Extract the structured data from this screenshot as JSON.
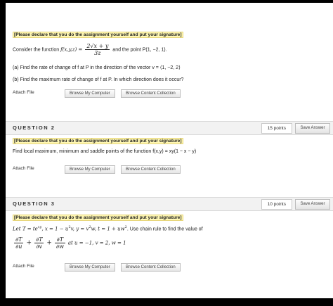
{
  "q1": {
    "declare": "[Please declare that you do the assignment yourself and put your signature]",
    "consider_prefix": "Consider the function",
    "function_lhs": "f(x,y,z) =",
    "numerator": "2√x + y",
    "denominator": "3z",
    "point_text": "and the point P(1, −2, 1).",
    "part_a": "(a) Find the rate of change of f at P in the direction of the vector v = ⟨1, −2, 2⟩",
    "part_b": "(b) Find the maximum rate of change of f at P. In which direction does it occur?",
    "attach_label": "Attach File",
    "browse_label": "Browse My Computer",
    "collection_label": "Browse Content Collection"
  },
  "q2": {
    "title": "QUESTION 2",
    "points": "15 points",
    "save_label": "Save Answer",
    "declare": "[Please declare that you do the assignment yourself and put your signature]",
    "prompt": "Find local maximum, minimum and saddle points of the function f(x,y) = xy(1 − x − y)",
    "attach_label": "Attach File",
    "browse_label": "Browse My Computer",
    "collection_label": "Browse Content Collection"
  },
  "q3": {
    "title": "QUESTION 3",
    "points": "10 points",
    "save_label": "Save Answer",
    "declare": "[Please declare that you do the assignment yourself and put your signature]",
    "let_line": "Let T = te",
    "let_exp": "xy",
    "let_rest": ", x = 1 − u",
    "u_exp": "2",
    "let_rest2": "v, y = v",
    "v_exp": "2",
    "let_rest3": "w, t = 1 + uw",
    "w_exp": "2",
    "let_tail": ". Use chain rule to find the value of",
    "d1_num": "∂T",
    "d1_den": "∂u",
    "d2_num": "∂T",
    "d2_den": "∂v",
    "d3_num": "∂T",
    "d3_den": "∂w",
    "at_text": "at u = −1, v = 2, w = 1",
    "attach_label": "Attach File",
    "browse_label": "Browse My Computer",
    "collection_label": "Browse Content Collection"
  }
}
